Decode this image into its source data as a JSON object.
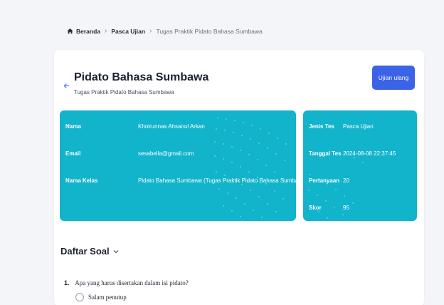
{
  "breadcrumb": {
    "items": [
      "Beranda",
      "Pasca Ujian",
      "Tugas Praktik Pidato Bahasa Sumbawa"
    ]
  },
  "header": {
    "title": "Pidato Bahasa Sumbawa",
    "subtitle": "Tugas Praktik Pidato Bahasa Sumbawa",
    "retry_label": "Ujian ulang"
  },
  "student_info": [
    {
      "label": "Nama",
      "value": "Khoirunnas Ahsanul Arkan"
    },
    {
      "label": "Email",
      "value": "sesabella@gmail.com"
    },
    {
      "label": "Nama Kelas",
      "value": "Pidato Bahasa Sumbawa (Tugas Praktik Pidato Bahasa Sumbawa)"
    }
  ],
  "test_info": [
    {
      "label": "Jenis Tes",
      "value": "Pasca Ujian"
    },
    {
      "label": "Tanggal Tes",
      "value": "2024-08-08 22:37:45"
    },
    {
      "label": "Pertanyaan",
      "value": "20"
    },
    {
      "label": "Skor",
      "value": "95"
    }
  ],
  "questions": {
    "section_title": "Daftar Soal",
    "items": [
      {
        "number": "1.",
        "text": "Apa yang harus disertakan dalam isi pidato?",
        "options": [
          "Salam penutup"
        ]
      }
    ]
  },
  "colors": {
    "accent": "#3b63e8",
    "panel": "#12b4cc",
    "background": "#f4f5f8"
  }
}
